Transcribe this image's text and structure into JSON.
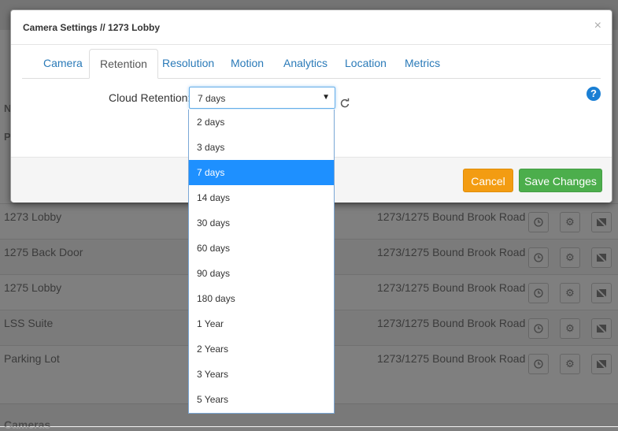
{
  "modal": {
    "title": "Camera Settings // 1273 Lobby",
    "close_glyph": "×",
    "tabs": [
      {
        "label": "Camera"
      },
      {
        "label": "Retention",
        "active": true
      },
      {
        "label": "Resolution"
      },
      {
        "label": "Analytics"
      },
      {
        "label": "Location"
      },
      {
        "label": "Metrics"
      },
      {
        "label": "Motion"
      }
    ],
    "cloud_retention": {
      "label": "Cloud Retention:",
      "value": "7 days",
      "arrow_glyph": "▼",
      "options": [
        "2 days",
        "3 days",
        "7 days",
        "14 days",
        "30 days",
        "60 days",
        "90 days",
        "180 days",
        "1 Year",
        "2 Years",
        "3 Years",
        "5 Years"
      ],
      "selected_index": 2
    },
    "help_glyph": "?",
    "cancel_label": "Cancel",
    "save_label": "Save Changes"
  },
  "background": {
    "rows": [
      {
        "name": "1273 Lobby",
        "location": "1273/1275 Bound Brook Road"
      },
      {
        "name": "1275 Back Door",
        "location": "1273/1275 Bound Brook Road"
      },
      {
        "name": "1275 Lobby",
        "location": "1273/1275 Bound Brook Road"
      },
      {
        "name": "LSS Suite",
        "location": "1273/1275 Bound Brook Road"
      },
      {
        "name": "Parking Lot",
        "location": "1273/1275 Bound Brook Road"
      }
    ],
    "footer_text": "Cameras"
  },
  "colors": {
    "link_blue": "#2a7ab8",
    "selected_option": "#1e90ff",
    "cancel_orange": "#f39c12",
    "save_green": "#4cae4c",
    "help_blue": "#1a7fd4"
  },
  "icons": [
    "close-icon",
    "dropdown-arrow-icon",
    "reset-icon",
    "help-icon",
    "clock-icon",
    "gear-icon",
    "no-image-icon"
  ]
}
